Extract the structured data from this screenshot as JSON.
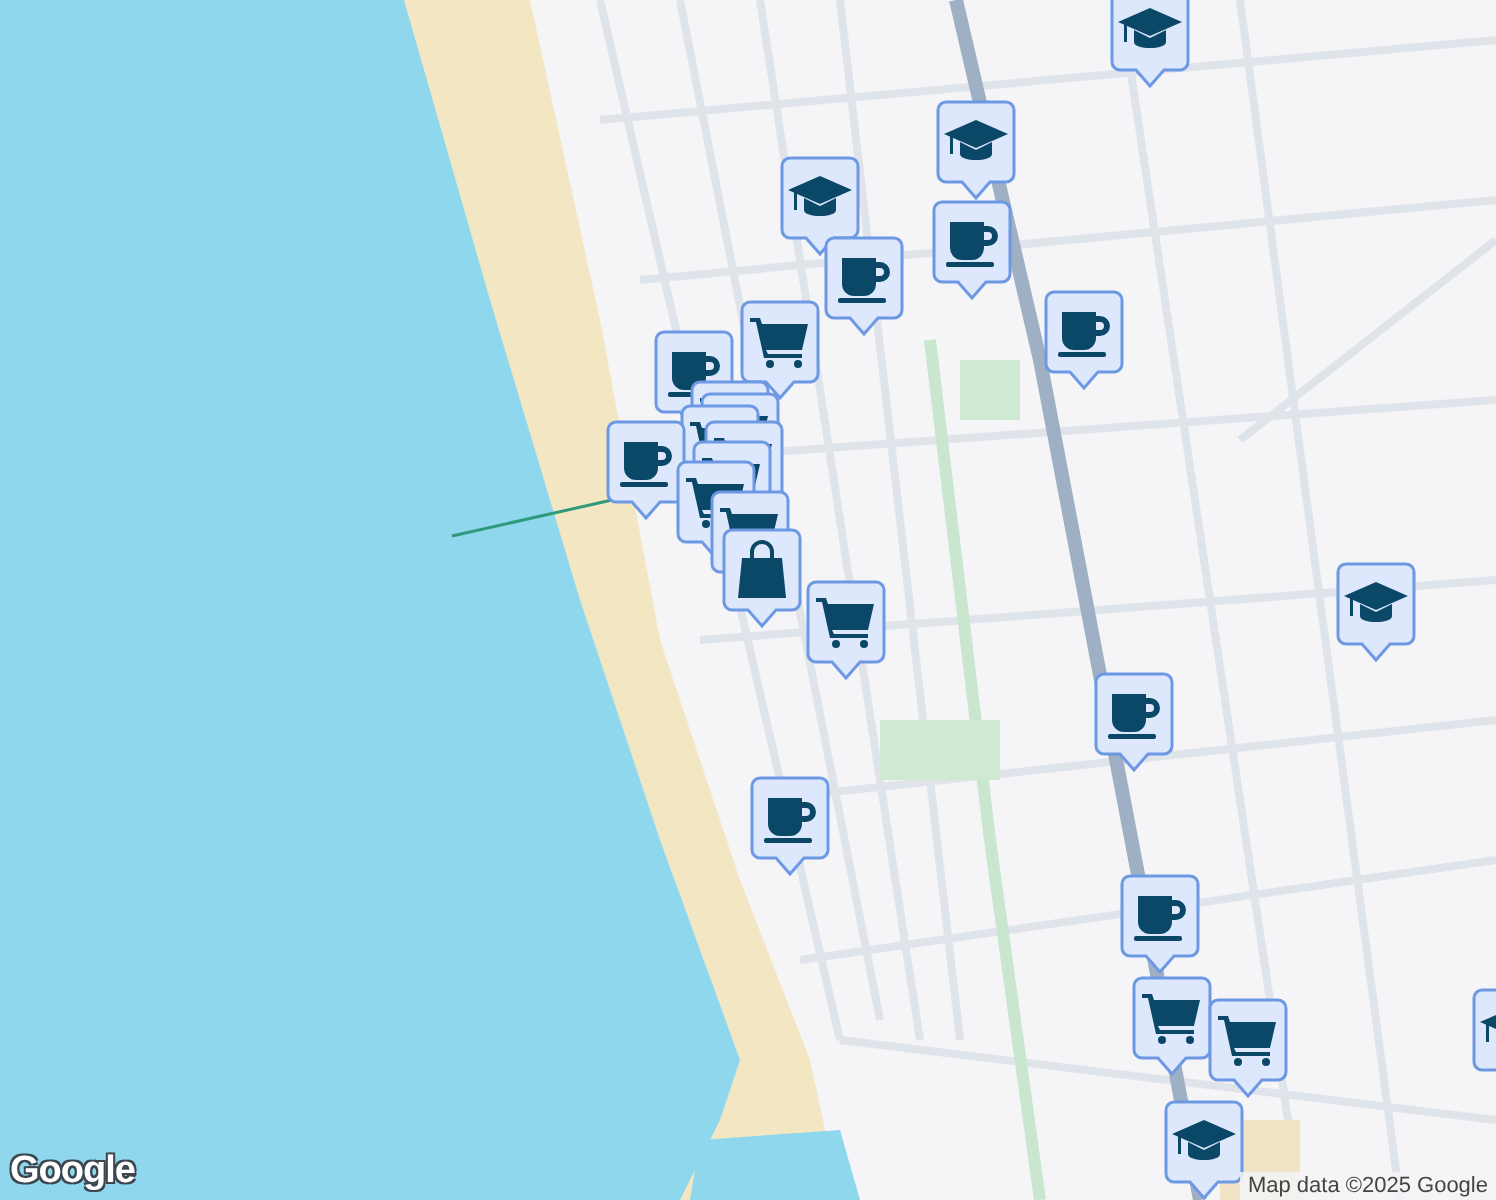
{
  "map": {
    "markers": [
      {
        "kind": "cap"
      },
      {
        "kind": "cap"
      },
      {
        "kind": "cap"
      },
      {
        "kind": "cup"
      },
      {
        "kind": "cup"
      },
      {
        "kind": "cup"
      },
      {
        "kind": "cart"
      },
      {
        "kind": "cart"
      },
      {
        "kind": "cup"
      },
      {
        "kind": "cart"
      },
      {
        "kind": "cart"
      },
      {
        "kind": "cart"
      },
      {
        "kind": "cart"
      },
      {
        "kind": "cup"
      },
      {
        "kind": "cart"
      },
      {
        "kind": "cart"
      },
      {
        "kind": "cart"
      },
      {
        "kind": "bag"
      },
      {
        "kind": "cart"
      },
      {
        "kind": "cap"
      },
      {
        "kind": "cup"
      },
      {
        "kind": "cup"
      },
      {
        "kind": "cup"
      },
      {
        "kind": "cart"
      },
      {
        "kind": "cart"
      },
      {
        "kind": "cap"
      },
      {
        "kind": "cap"
      }
    ]
  },
  "attribution": {
    "logo": "Google",
    "text": "Map data ©2025 Google"
  }
}
